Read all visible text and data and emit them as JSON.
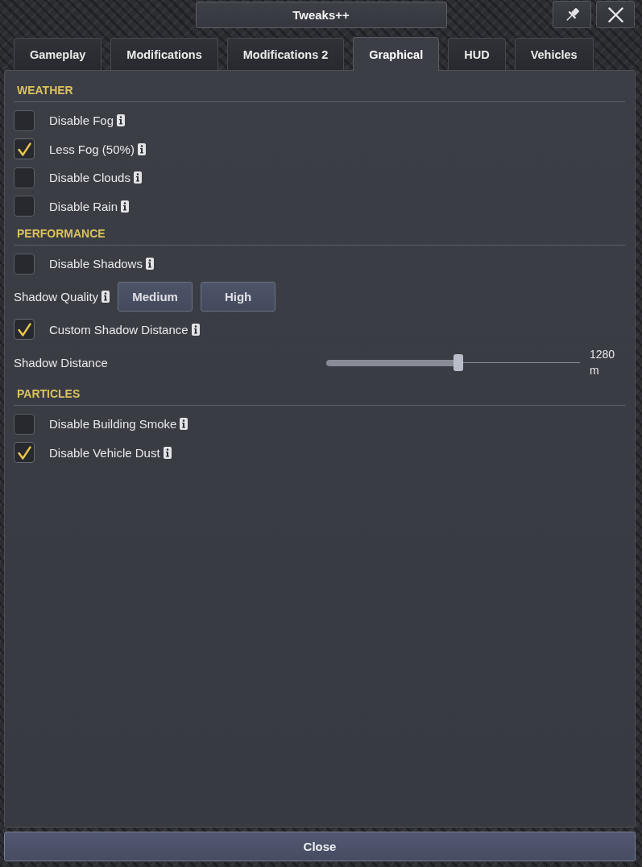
{
  "window": {
    "title": "Tweaks++"
  },
  "tabs": [
    {
      "label": "Gameplay",
      "selected": false
    },
    {
      "label": "Modifications",
      "selected": false
    },
    {
      "label": "Modifications 2",
      "selected": false
    },
    {
      "label": "Graphical",
      "selected": true
    },
    {
      "label": "HUD",
      "selected": false
    },
    {
      "label": "Vehicles",
      "selected": false
    }
  ],
  "sections": [
    {
      "heading": "WEATHER",
      "items": [
        {
          "kind": "checkbox",
          "label": "Disable Fog",
          "checked": false,
          "info": true
        },
        {
          "kind": "checkbox",
          "label": "Less Fog (50%)",
          "checked": true,
          "info": true
        },
        {
          "kind": "checkbox",
          "label": "Disable Clouds",
          "checked": false,
          "info": true
        },
        {
          "kind": "checkbox",
          "label": "Disable Rain",
          "checked": false,
          "info": true
        }
      ]
    },
    {
      "heading": "PERFORMANCE",
      "items": [
        {
          "kind": "checkbox",
          "label": "Disable Shadows",
          "checked": false,
          "info": true
        },
        {
          "kind": "choice",
          "label": "Shadow Quality",
          "info": true,
          "options": [
            {
              "label": "Medium",
              "selected": false
            },
            {
              "label": "High",
              "selected": false
            }
          ]
        },
        {
          "kind": "checkbox",
          "label": "Custom Shadow Distance",
          "checked": true,
          "info": true
        },
        {
          "kind": "slider",
          "label": "Shadow Distance",
          "info": false,
          "level": 0.52,
          "reading": "1280 m"
        }
      ]
    },
    {
      "heading": "PARTICLES",
      "items": [
        {
          "kind": "checkbox",
          "label": "Disable Building Smoke",
          "checked": false,
          "info": true
        },
        {
          "kind": "checkbox",
          "label": "Disable Vehicle Dust",
          "checked": true,
          "info": true
        }
      ]
    }
  ],
  "footer": {
    "button": "Close"
  }
}
